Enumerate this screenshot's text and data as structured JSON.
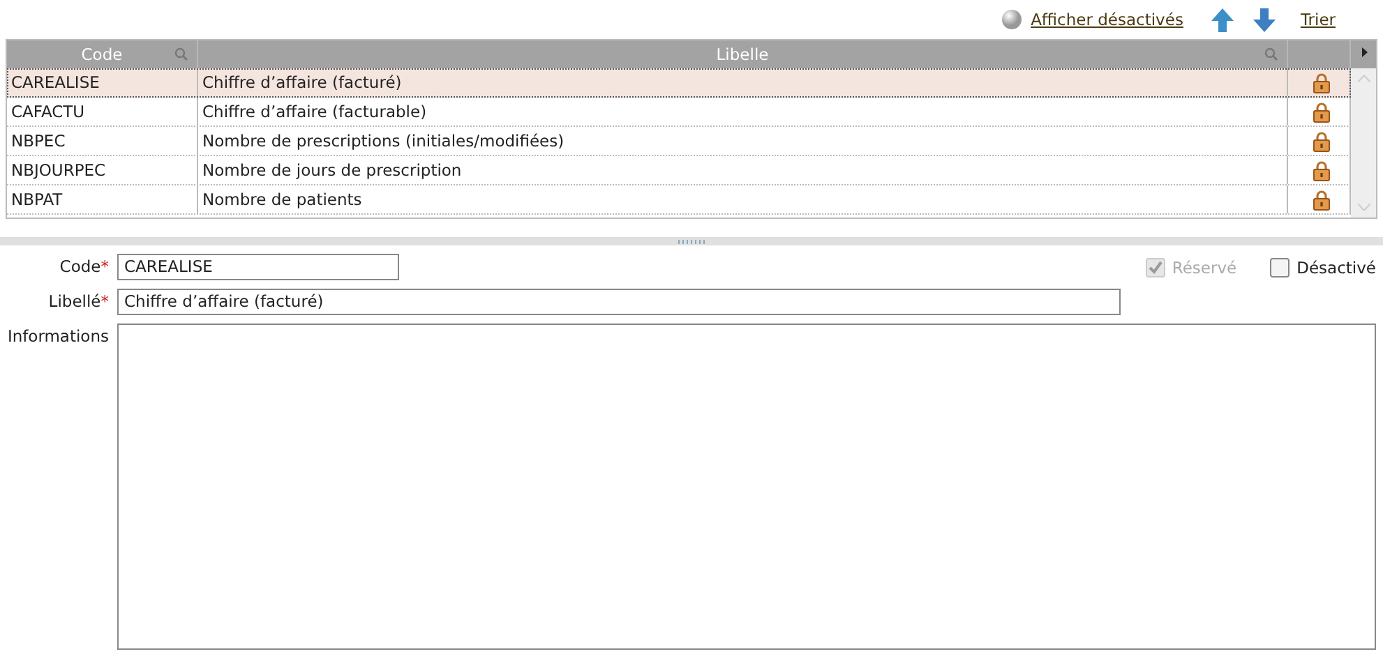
{
  "toolbar": {
    "show_disabled": "Afficher désactivés",
    "sort": "Trier"
  },
  "table": {
    "columns": [
      "Code",
      "Libelle"
    ],
    "rows": [
      {
        "code": "CAREALISE",
        "label": "Chiffre d’affaire (facturé)",
        "locked": true,
        "selected": true
      },
      {
        "code": "CAFACTU",
        "label": "Chiffre d’affaire (facturable)",
        "locked": true,
        "selected": false
      },
      {
        "code": "NBPEC",
        "label": "Nombre de prescriptions (initiales/modifiées)",
        "locked": true,
        "selected": false
      },
      {
        "code": "NBJOURPEC",
        "label": "Nombre de jours de prescription",
        "locked": true,
        "selected": false
      },
      {
        "code": "NBPAT",
        "label": "Nombre de patients",
        "locked": true,
        "selected": false
      }
    ]
  },
  "form": {
    "code": {
      "label": "Code",
      "required_mark": "*",
      "value": "CAREALISE"
    },
    "libelle": {
      "label": "Libellé",
      "required_mark": "*",
      "value": "Chiffre d’affaire (facturé)"
    },
    "informations": {
      "label": "Informations"
    },
    "checkboxes": [
      {
        "label": "Réservé",
        "checked": true,
        "disabled": true
      },
      {
        "label": "Désactivé",
        "checked": false,
        "disabled": false
      }
    ]
  }
}
